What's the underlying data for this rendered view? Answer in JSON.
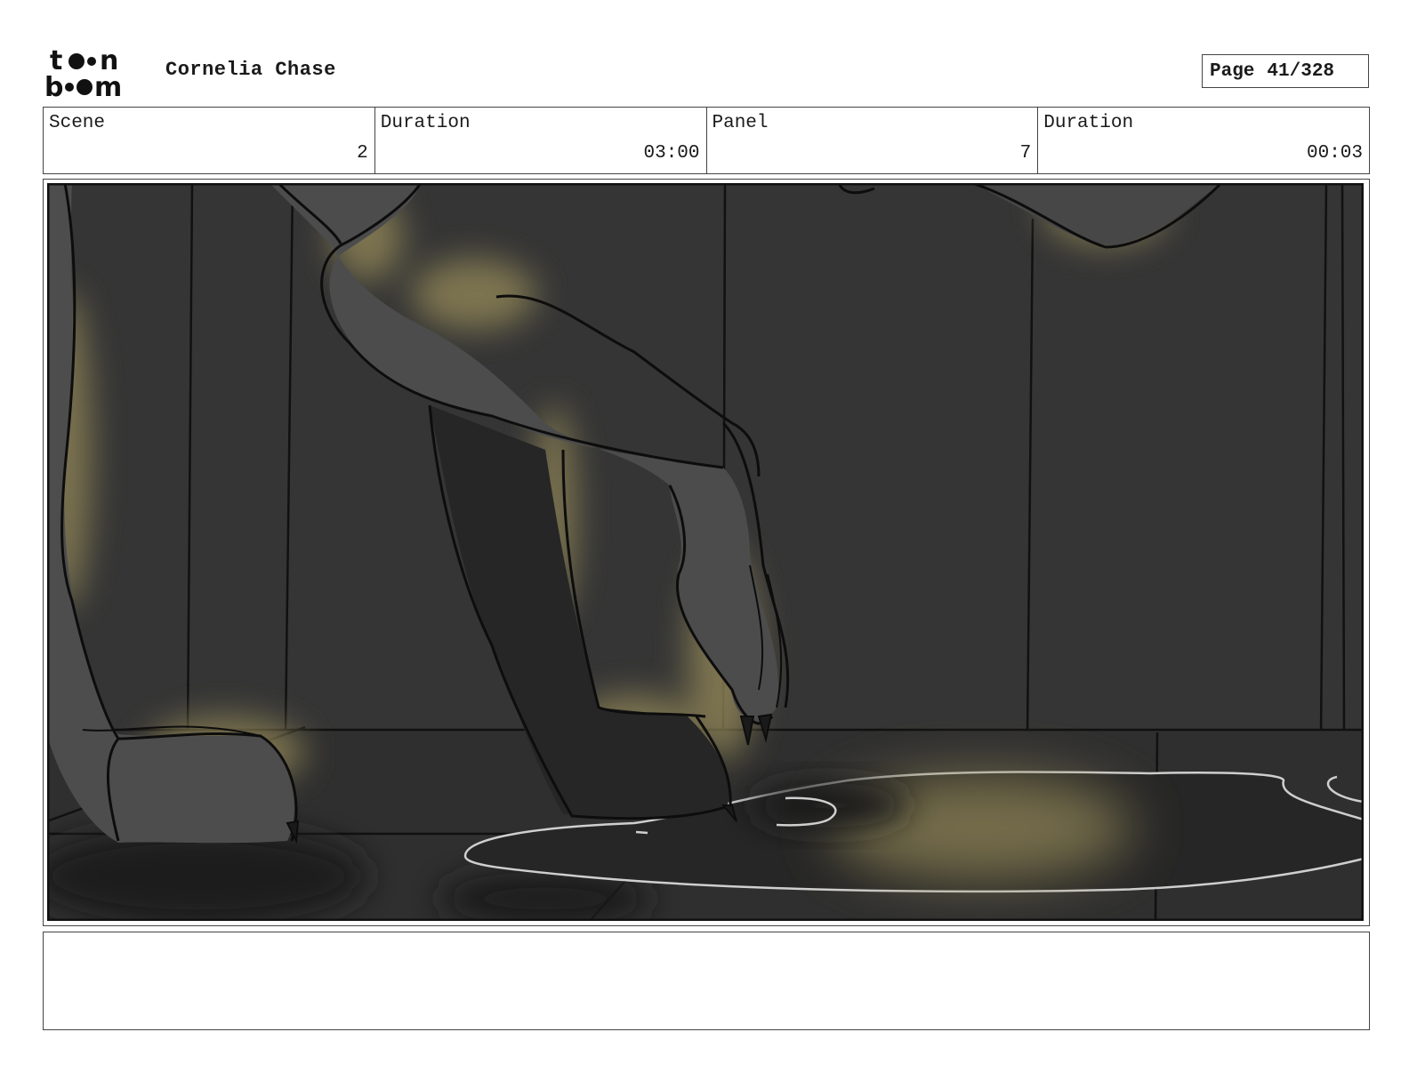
{
  "header": {
    "logo_text_top": "toon",
    "logo_text_bottom": "boom",
    "project_title": "Cornelia Chase",
    "page_label": "Page",
    "page_value": "41/328"
  },
  "info": {
    "scene_label": "Scene",
    "scene_value": "2",
    "scene_duration_label": "Duration",
    "scene_duration_value": "03:00",
    "panel_label": "Panel",
    "panel_value": "7",
    "panel_duration_label": "Duration",
    "panel_duration_value": "00:03"
  },
  "notes": {
    "text": ""
  },
  "colors": {
    "wall": "#333333",
    "floor": "#2e2e2e",
    "figure_dark": "#2a2a2a",
    "figure_mid": "#4a4a4a",
    "glow": "#8f8456",
    "puddle_outline": "#cfcfcf",
    "line": "#0d0d0d"
  }
}
